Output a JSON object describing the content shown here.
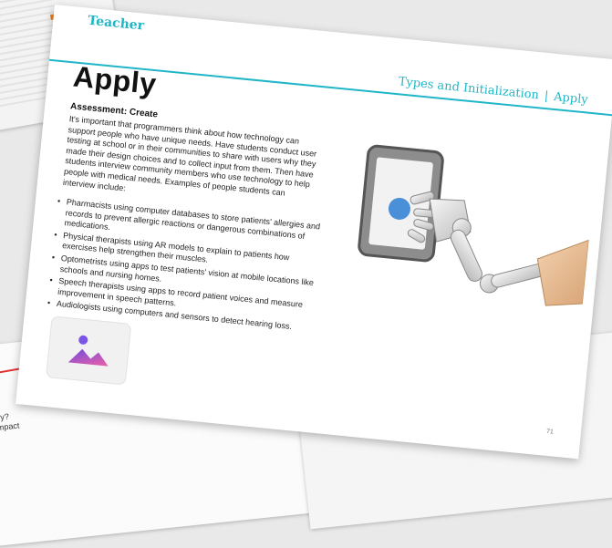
{
  "slide": {
    "teacher_label": "Teacher",
    "breadcrumb": {
      "section": "Types and Initialization",
      "separator": "|",
      "current": "Apply"
    },
    "title": "Apply",
    "subheading": "Assessment: Create",
    "intro": "It's important that programmers think about how technology can support people who have unique needs. Have students conduct user testing at school or in their communities to share with users why they made their design choices and to collect input from them. Then have students interview community members who use technology to help people with medical needs. Examples of people students can interview include:",
    "bullets": [
      "Pharmacists using computer databases to store patients' allergies and records to prevent allergic reactions or dangerous combinations of medications.",
      "Physical therapists using AR models to explain to patients how exercises help strengthen their muscles.",
      "Optometrists using apps to test patients' vision at mobile locations like schools and nursing homes.",
      "Speech therapists using apps to record patient voices and measure improvement in speech patterns.",
      "Audiologists using computers and sensors to detect hearing loss."
    ],
    "page_number": "71",
    "placeholder_icon": "image-icon",
    "illustration_icon": "robot-hand-tapping-tablet-icon"
  },
  "background_snippet": {
    "lines": [
      "ify?",
      "mpact"
    ]
  },
  "colors": {
    "accent": "#1fb6c8",
    "orange": "#ef7d22",
    "tablet_button": "#4a90d9"
  }
}
